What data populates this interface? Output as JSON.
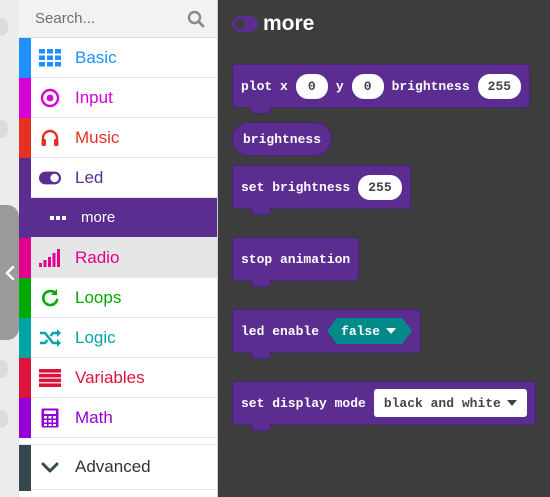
{
  "search": {
    "placeholder": "Search..."
  },
  "categories": [
    {
      "label": "Basic",
      "color": "#1e90ff",
      "icon": "grid-icon"
    },
    {
      "label": "Input",
      "color": "#d400d4",
      "icon": "target-icon"
    },
    {
      "label": "Music",
      "color": "#e63022",
      "icon": "headphones-icon"
    },
    {
      "label": "Led",
      "color": "#5c2d91",
      "icon": "toggle-icon"
    },
    {
      "label": "more",
      "color": "#5c2d91",
      "icon": "ellipsis-icon"
    },
    {
      "label": "Radio",
      "color": "#e3008c",
      "icon": "signal-bars-icon"
    },
    {
      "label": "Loops",
      "color": "#00aa00",
      "icon": "loop-arrow-icon"
    },
    {
      "label": "Logic",
      "color": "#00a4a6",
      "icon": "shuffle-icon"
    },
    {
      "label": "Variables",
      "color": "#dc143c",
      "icon": "list-icon"
    },
    {
      "label": "Math",
      "color": "#9400d3",
      "icon": "calculator-icon"
    },
    {
      "label": "Advanced",
      "color": "#37474f",
      "icon": "chevron-down-icon"
    }
  ],
  "flyout": {
    "title": "more",
    "blocks": {
      "plot": {
        "kw1": "plot x",
        "x": "0",
        "kw2": "y",
        "y": "0",
        "kw3": "brightness",
        "brightness": "255"
      },
      "brightness_reporter": {
        "label": "brightness"
      },
      "set_brightness": {
        "kw": "set brightness",
        "value": "255"
      },
      "stop_animation": {
        "label": "stop animation"
      },
      "led_enable": {
        "kw": "led enable",
        "value": "false"
      },
      "display_mode": {
        "kw": "set display mode",
        "value": "black and white"
      }
    }
  },
  "colors": {
    "led_purple": "#5c2d91",
    "logic_teal": "#008a8a",
    "workspace": "#3d3d3d"
  }
}
